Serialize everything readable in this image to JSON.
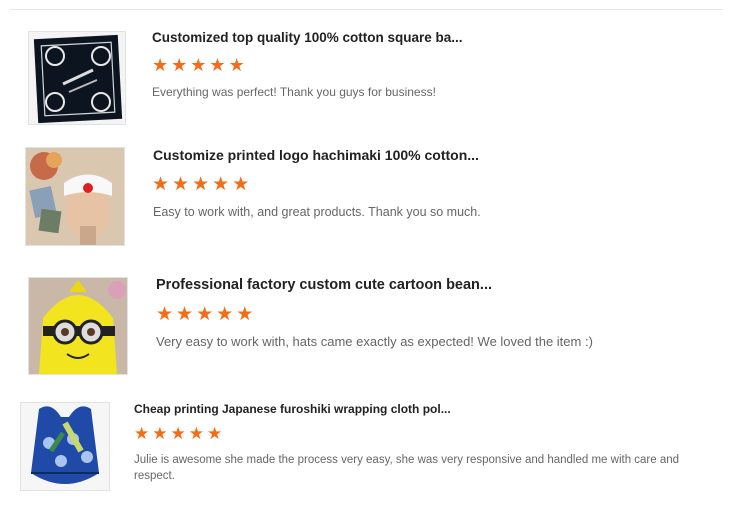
{
  "colors": {
    "star": "#f36c16",
    "title": "#222222",
    "comment": "#666666",
    "divider": "#e6e6e6"
  },
  "reviews": [
    {
      "product_title": "Customized top quality 100% cotton square ba...",
      "rating": 5,
      "comment": "Everything was perfect! Thank you guys for business!",
      "image": "black-paisley-bandana"
    },
    {
      "product_title": "Customize printed logo hachimaki 100% cotton...",
      "rating": 5,
      "comment": "Easy to work with, and great products. Thank you so much.",
      "image": "white-hachimaki-headband-on-mannequin"
    },
    {
      "product_title": "Professional factory custom cute cartoon bean...",
      "rating": 5,
      "comment": "Very easy to work with, hats came exactly as expected! We loved the item :)",
      "image": "yellow-minion-beanie"
    },
    {
      "product_title": "Cheap printing Japanese furoshiki wrapping cloth pol...",
      "rating": 5,
      "comment": "Julie is awesome she made the process very easy, she was very responsive and handled me with care and respect.",
      "image": "blue-furoshiki-cloth"
    }
  ]
}
